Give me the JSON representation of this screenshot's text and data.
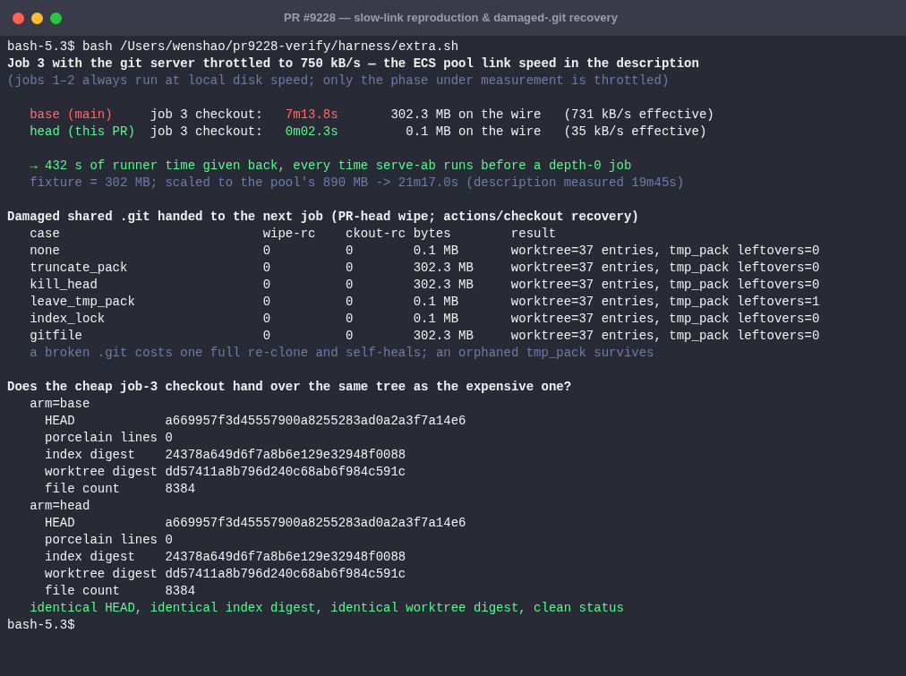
{
  "window": {
    "title": "PR #9228 — slow-link reproduction & damaged-.git recovery"
  },
  "command": {
    "prompt": "bash-5.3$",
    "text": "bash /Users/wenshao/pr9228-verify/harness/extra.sh"
  },
  "throttle": {
    "heading": "Job 3 with the git server throttled to 750 kB/s — the ECS pool link speed in the description",
    "note": "(jobs 1–2 always run at local disk speed; only the phase under measurement is throttled)",
    "arms": [
      {
        "label": "base (main)",
        "color": "#ff6b6b",
        "metric": "job 3 checkout:",
        "time": "7m13.8s",
        "bytes": "302.3 MB on the wire",
        "rate": "(731 kB/s effective)"
      },
      {
        "label": "head (this PR)",
        "color": "#5af78e",
        "metric": "job 3 checkout:",
        "time": "0m02.3s",
        "bytes": "0.1 MB on the wire",
        "rate": "(35 kB/s effective)"
      }
    ],
    "summary": [
      {
        "kind": "highlight",
        "text": "→ 432 s of runner time given back, every time serve-ab runs before a depth-0 job"
      },
      {
        "kind": "note",
        "text": "fixture = 302 MB; scaled to the pool's 890 MB -> 21m17.0s (description measured 19m45s)"
      }
    ]
  },
  "damaged": {
    "heading": "Damaged shared .git handed to the next job (PR-head wipe; actions/checkout recovery)",
    "columns": [
      "case",
      "wipe-rc",
      "ckout-rc",
      "bytes",
      "result"
    ],
    "rows": [
      [
        "none",
        "0",
        "0",
        "0.1 MB",
        "worktree=37 entries, tmp_pack leftovers=0"
      ],
      [
        "truncate_pack",
        "0",
        "0",
        "302.3 MB",
        "worktree=37 entries, tmp_pack leftovers=0"
      ],
      [
        "kill_head",
        "0",
        "0",
        "302.3 MB",
        "worktree=37 entries, tmp_pack leftovers=0"
      ],
      [
        "leave_tmp_pack",
        "0",
        "0",
        "0.1 MB",
        "worktree=37 entries, tmp_pack leftovers=1"
      ],
      [
        "index_lock",
        "0",
        "0",
        "0.1 MB",
        "worktree=37 entries, tmp_pack leftovers=0"
      ],
      [
        "gitfile",
        "0",
        "0",
        "302.3 MB",
        "worktree=37 entries, tmp_pack leftovers=0"
      ]
    ],
    "note": "a broken .git costs one full re-clone and self-heals; an orphaned tmp_pack survives"
  },
  "tree": {
    "heading": "Does the cheap job-3 checkout hand over the same tree as the expensive one?",
    "arms": [
      {
        "name": "arm=base",
        "fields": [
          {
            "label": "HEAD",
            "value": "a669957f3d45557900a8255283ad0a2a3f7a14e6"
          },
          {
            "label": "porcelain lines",
            "value": "0"
          },
          {
            "label": "index digest",
            "value": "24378a649d6f7a8b6e129e32948f0088"
          },
          {
            "label": "worktree digest",
            "value": "dd57411a8b796d240c68ab6f984c591c"
          },
          {
            "label": "file count",
            "value": "8384"
          }
        ]
      },
      {
        "name": "arm=head",
        "fields": [
          {
            "label": "HEAD",
            "value": "a669957f3d45557900a8255283ad0a2a3f7a14e6"
          },
          {
            "label": "porcelain lines",
            "value": "0"
          },
          {
            "label": "index digest",
            "value": "24378a649d6f7a8b6e129e32948f0088"
          },
          {
            "label": "worktree digest",
            "value": "dd57411a8b796d240c68ab6f984c591c"
          },
          {
            "label": "file count",
            "value": "8384"
          }
        ]
      }
    ],
    "conclusion": "identical HEAD, identical index digest, identical worktree digest, clean status"
  },
  "final_prompt": "bash-5.3$"
}
